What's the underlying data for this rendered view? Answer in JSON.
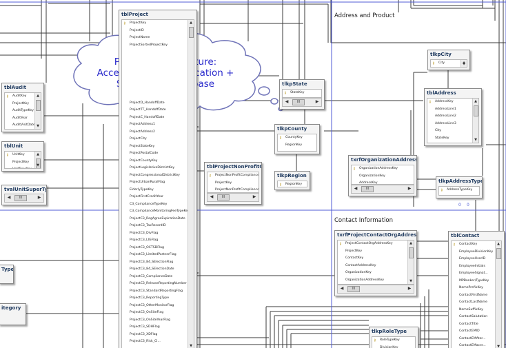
{
  "callout": {
    "line1": "Powerful architecture:",
    "line2": "Access desktop application +",
    "line3": "SQL Server database"
  },
  "labels": {
    "address_product": "Address and Product",
    "contact_info": "Contact Information"
  },
  "tables": {
    "tblProject": {
      "title": "tblProject",
      "fields": [
        "ProjectKey",
        "ProjectID",
        "ProjectName",
        "ProjectSortedProjectKey",
        "",
        "",
        "",
        "",
        "",
        "",
        "",
        "ProjectD_HandoffDate",
        "ProjectTT_HandoffDate",
        "ProjectC_HandoffDate",
        "ProjectAddress1",
        "ProjectAddress2",
        "ProjectCity",
        "ProjectStateKey",
        "ProjectPostalCode",
        "ProjectCountyKey",
        "ProjectLegislativeDistrictKey",
        "ProjectCongressionalDistrictKey",
        "ProjectUrbanRuralFlag",
        "ElderlyTypeKey",
        "ProjectFirstCreditYear",
        "C3_ComplianceTypeKey",
        "C3_ComplianceMonitoringFeeTypeKey",
        "ProjectC3_RegAgreeExpirationDate",
        "ProjectC3_TaxRecordID",
        "ProjectC3_DivFlag",
        "ProjectC3_LIGFlag",
        "ProjectC3_OCTSDFlag",
        "ProjectC3_LimitedPartnerFlag",
        "ProjectC3_84_SElectionFlag",
        "ProjectC3_84_SElectionDate",
        "ProjectC3_ComplianceDate",
        "ProjectC3_ReleaseReportingNumber",
        "ProjectC3_StandardReportingFlag",
        "ProjectC3_ReportingType",
        "ProjectC3_OtherMonitorFlag",
        "ProjectC3_OnSiteFlag",
        "ProjectC3_OnSiteYearFlag",
        "ProjectC3_SDHFlag",
        "ProjectC3_XDFlag",
        "ProjectC3_Risk_Cl..."
      ]
    },
    "tblAudit": {
      "title": "tblAudit",
      "fields": [
        "AuditKey",
        "ProjectKey",
        "AuditTypeKey",
        "AuditYear",
        "AuditVisitDate"
      ]
    },
    "tblUnit": {
      "title": "tblUnit",
      "fields": [
        "UnitKey",
        "ProjectKey",
        "UnitTypeKey"
      ]
    },
    "tvalUnitSuperType": {
      "title": "tvalUnitSuperTypel",
      "fields": []
    },
    "tType": {
      "title": "Type",
      "fields": []
    },
    "tCategory": {
      "title": "itegory",
      "fields": []
    },
    "tlkpState": {
      "title": "tlkpState",
      "fields": [
        "StateKey",
        "StateName"
      ]
    },
    "tlkpCounty": {
      "title": "tlkpCounty",
      "fields": [
        "CountyKey",
        "RegionKey"
      ]
    },
    "tlkpRegion": {
      "title": "tlkpRegion",
      "fields": [
        "RegionKey"
      ]
    },
    "tblProjectNonProfit": {
      "title": "tblProjectNonProfitCompli",
      "fields": [
        "ProjectNonProfitComplianceKey",
        "ProjectKey",
        "ProjectNonProfitComplianceSel"
      ]
    },
    "tlkpCity": {
      "title": "tlkpCity",
      "fields": [
        "City",
        "CityKey"
      ]
    },
    "tblAddress": {
      "title": "tblAddress",
      "fields": [
        "AddressKey",
        "AddressLine1",
        "AddressLine2",
        "AddressLine3",
        "City",
        "StateKey",
        "AddressPostalCode"
      ]
    },
    "txrfOrganizationAddress": {
      "title": "txrfOrganizationAddress",
      "fields": [
        "OrganizationAddressKey",
        "OrganizationKey",
        "AddressKey"
      ]
    },
    "tlkpAddressType": {
      "title": "tlkpAddressType",
      "fields": [
        "AddressTypeKey"
      ]
    },
    "txrfProjectContactOrgAddress": {
      "title": "txrfProjectContactOrgAddress",
      "fields": [
        "ProjectContactOrgAddressKey",
        "ProjectKey",
        "ContactKey",
        "ContactAddressKey",
        "OrganizationKey",
        "OrganizationAddressKey",
        "SelectedAddressFlag_OAC"
      ]
    },
    "tlkpRoleType": {
      "title": "tlkpRoleType",
      "fields": [
        "RoleTypeKey",
        "DivisionKey"
      ]
    },
    "tblContact": {
      "title": "tblContact",
      "fields": [
        "ContactKey",
        "EmployeeDivisionKey",
        "EmployeeUserID",
        "EmployeeInitials",
        "EmployeeSignat...",
        "MPBanker/TypeKey",
        "NamePrefixKey",
        "ContactFirstName",
        "ContactLastName",
        "NameSuffixKey",
        "ContactSalutation",
        "ContactTitle",
        "ContactEMID",
        "ContactEMAter...",
        "ContactEMacer..."
      ]
    }
  }
}
